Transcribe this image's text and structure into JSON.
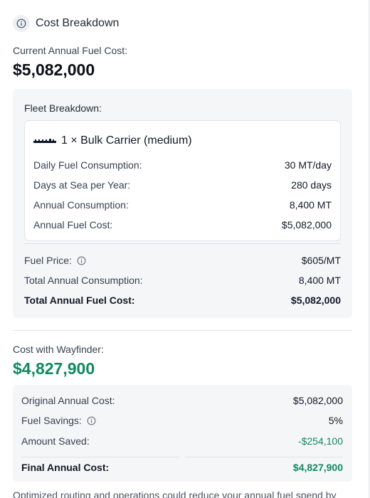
{
  "header": {
    "title": "Cost Breakdown",
    "icon": "info-icon"
  },
  "current": {
    "label": "Current Annual Fuel Cost:",
    "value": "$5,082,000"
  },
  "fleet": {
    "title": "Fleet Breakdown:",
    "vessel": {
      "icon": "ship-icon",
      "name": "1 × Bulk Carrier (medium)",
      "rows": [
        {
          "label": "Daily Fuel Consumption:",
          "value": "30 MT/day"
        },
        {
          "label": "Days at Sea per Year:",
          "value": "280 days"
        },
        {
          "label": "Annual Consumption:",
          "value": "8,400 MT"
        },
        {
          "label": "Annual Fuel Cost:",
          "value": "$5,082,000"
        }
      ]
    },
    "fuel_price": {
      "label": "Fuel Price:",
      "value": "$605/MT"
    },
    "total_consumption": {
      "label": "Total Annual Consumption:",
      "value": "8,400 MT"
    },
    "total_cost": {
      "label": "Total Annual Fuel Cost:",
      "value": "$5,082,000"
    }
  },
  "wayfinder": {
    "label": "Cost with Wayfinder:",
    "value": "$4,827,900",
    "accent_color": "#0f8a5f",
    "rows": [
      {
        "label": "Original Annual Cost:",
        "value": "$5,082,000"
      },
      {
        "label": "Fuel Savings:",
        "value": "5%"
      },
      {
        "label": "Amount Saved:",
        "value": "-$254,100"
      }
    ],
    "final": {
      "label": "Final Annual Cost:",
      "value": "$4,827,900"
    }
  },
  "footer": {
    "note": "Optimized routing and operations could reduce your annual fuel spend by"
  }
}
